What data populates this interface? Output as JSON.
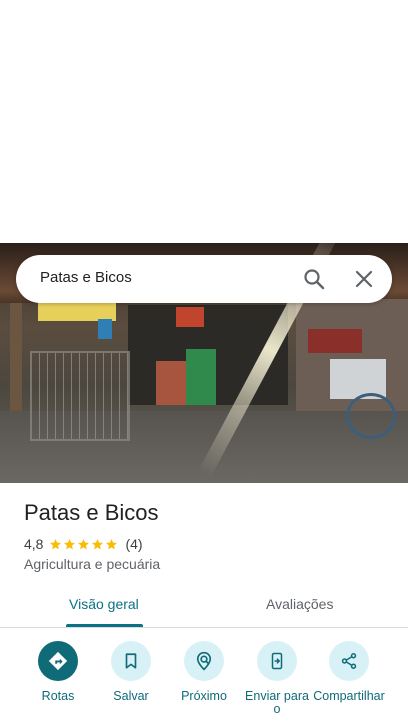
{
  "search": {
    "query": "Patas e Bicos"
  },
  "place": {
    "name": "Patas e Bicos",
    "rating": "4,8",
    "stars": 4.8,
    "review_count": "(4)",
    "category": "Agricultura e pecuária"
  },
  "tabs": [
    {
      "label": "Visão geral",
      "selected": true
    },
    {
      "label": "Avaliações",
      "selected": false
    }
  ],
  "actions": [
    {
      "label": "Rotas",
      "icon": "directions-icon"
    },
    {
      "label": "Salvar",
      "icon": "bookmark-icon"
    },
    {
      "label": "Próximo",
      "icon": "nearby-icon"
    },
    {
      "label": "Enviar para o",
      "icon": "send-to-phone-icon"
    },
    {
      "label": "Compartilhar",
      "icon": "share-icon"
    }
  ],
  "colors": {
    "accent": "#0f6b78",
    "accent_light": "#d8f1f6",
    "star": "#fbbc04"
  }
}
